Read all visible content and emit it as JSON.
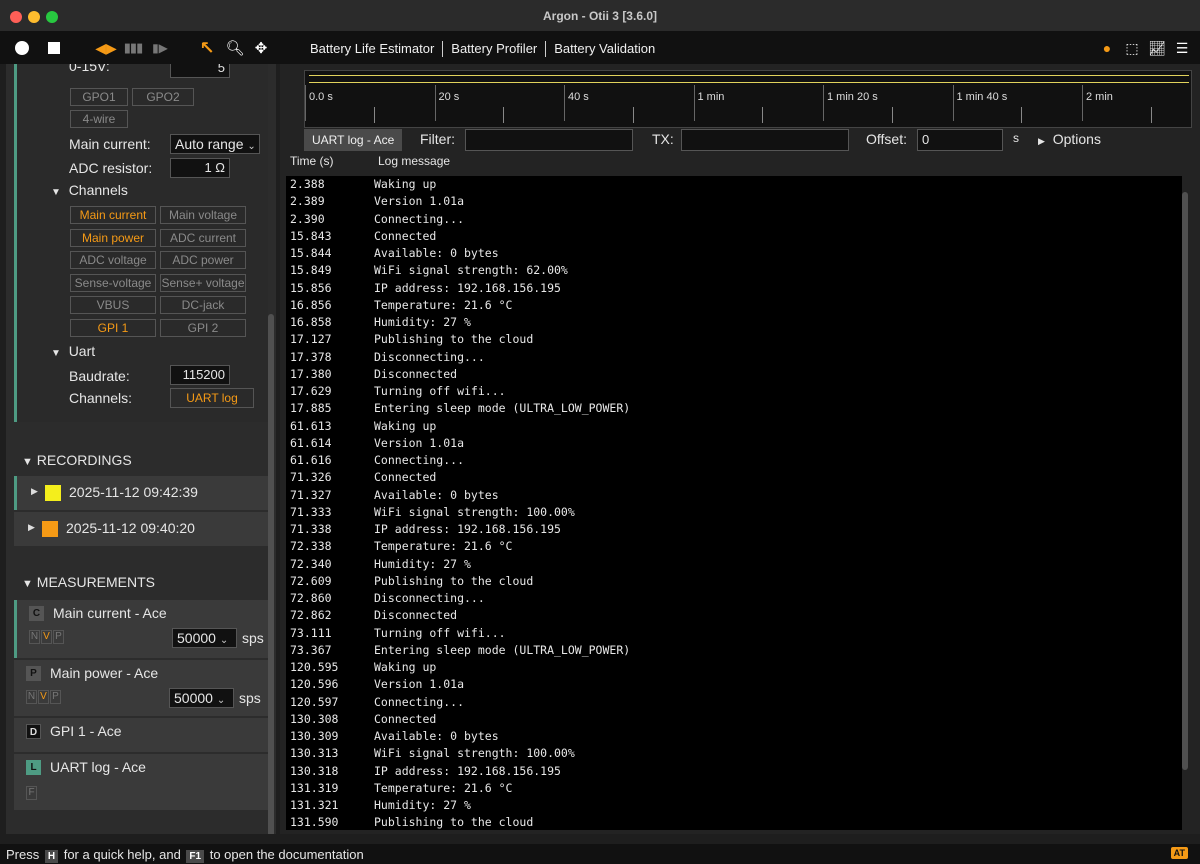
{
  "window": {
    "title": "Argon - Otii 3 [3.6.0]"
  },
  "toolbar": {
    "menu": [
      "Battery Life Estimator",
      "Battery Profiler",
      "Battery Validation"
    ]
  },
  "device": {
    "voltage_label": "0-15V:",
    "voltage_value": "5",
    "gpo": [
      "GPO1",
      "GPO2"
    ],
    "fourwire": "4-wire",
    "main_current_label": "Main current:",
    "main_current_value": "Auto range",
    "adc_resistor_label": "ADC resistor:",
    "adc_resistor_value": "1 Ω",
    "channels_label": "Channels",
    "channels": [
      {
        "label": "Main current",
        "on": true
      },
      {
        "label": "Main voltage",
        "on": false
      },
      {
        "label": "Main power",
        "on": true
      },
      {
        "label": "ADC current",
        "on": false
      },
      {
        "label": "ADC voltage",
        "on": false
      },
      {
        "label": "ADC power",
        "on": false
      },
      {
        "label": "Sense-voltage",
        "on": false
      },
      {
        "label": "Sense+ voltage",
        "on": false
      },
      {
        "label": "VBUS",
        "on": false
      },
      {
        "label": "DC-jack",
        "on": false
      },
      {
        "label": "GPI 1",
        "on": true
      },
      {
        "label": "GPI 2",
        "on": false
      }
    ],
    "uart_label": "Uart",
    "baudrate_label": "Baudrate:",
    "baudrate_value": "115200",
    "uart_channels_label": "Channels:",
    "uart_channel": "UART log"
  },
  "recordings": {
    "header": "RECORDINGS",
    "items": [
      {
        "label": "2025-11-12 09:42:39",
        "color": "#f4ee1c"
      },
      {
        "label": "2025-11-12 09:40:20",
        "color": "#f59a16"
      }
    ]
  },
  "measurements": {
    "header": "MEASUREMENTS",
    "items": [
      {
        "icon": "C",
        "label": "Main current - Ace",
        "sps": "50000",
        "unit": "sps"
      },
      {
        "icon": "P",
        "label": "Main power - Ace",
        "sps": "50000",
        "unit": "sps"
      },
      {
        "icon": "D",
        "label": "GPI 1 - Ace"
      },
      {
        "icon": "L",
        "label": "UART log - Ace",
        "filter": "F"
      }
    ],
    "nvp": [
      "N",
      "V",
      "P"
    ]
  },
  "timeline": {
    "ticks": [
      "0.0 s",
      "20 s",
      "40 s",
      "1 min",
      "1 min 20 s",
      "1 min 40 s",
      "2 min"
    ]
  },
  "log": {
    "tab": "UART log - Ace",
    "filter_label": "Filter:",
    "filter_value": "",
    "tx_label": "TX:",
    "tx_value": "",
    "offset_label": "Offset:",
    "offset_value": "0",
    "offset_unit": "s",
    "options_label": "Options",
    "col_time": "Time (s)",
    "col_msg": "Log message",
    "rows": [
      [
        "2.388",
        "Waking up"
      ],
      [
        "2.389",
        "Version 1.01a"
      ],
      [
        "2.390",
        "Connecting..."
      ],
      [
        "15.843",
        "Connected"
      ],
      [
        "15.844",
        "Available: 0 bytes"
      ],
      [
        "15.849",
        "WiFi signal strength: 62.00%"
      ],
      [
        "15.856",
        "IP address: 192.168.156.195"
      ],
      [
        "16.856",
        "Temperature: 21.6 °C"
      ],
      [
        "16.858",
        "Humidity: 27 %"
      ],
      [
        "17.127",
        "Publishing to the cloud"
      ],
      [
        "17.378",
        "Disconnecting..."
      ],
      [
        "17.380",
        "Disconnected"
      ],
      [
        "17.629",
        "Turning off wifi..."
      ],
      [
        "17.885",
        "Entering sleep mode (ULTRA_LOW_POWER)"
      ],
      [
        "61.613",
        "Waking up"
      ],
      [
        "61.614",
        "Version 1.01a"
      ],
      [
        "61.616",
        "Connecting..."
      ],
      [
        "71.326",
        "Connected"
      ],
      [
        "71.327",
        "Available: 0 bytes"
      ],
      [
        "71.333",
        "WiFi signal strength: 100.00%"
      ],
      [
        "71.338",
        "IP address: 192.168.156.195"
      ],
      [
        "72.338",
        "Temperature: 21.6 °C"
      ],
      [
        "72.340",
        "Humidity: 27 %"
      ],
      [
        "72.609",
        "Publishing to the cloud"
      ],
      [
        "72.860",
        "Disconnecting..."
      ],
      [
        "72.862",
        "Disconnected"
      ],
      [
        "73.111",
        "Turning off wifi..."
      ],
      [
        "73.367",
        "Entering sleep mode (ULTRA_LOW_POWER)"
      ],
      [
        "120.595",
        "Waking up"
      ],
      [
        "120.596",
        "Version 1.01a"
      ],
      [
        "120.597",
        "Connecting..."
      ],
      [
        "130.308",
        "Connected"
      ],
      [
        "130.309",
        "Available: 0 bytes"
      ],
      [
        "130.313",
        "WiFi signal strength: 100.00%"
      ],
      [
        "130.318",
        "IP address: 192.168.156.195"
      ],
      [
        "131.319",
        "Temperature: 21.6 °C"
      ],
      [
        "131.321",
        "Humidity: 27 %"
      ],
      [
        "131.590",
        "Publishing to the cloud"
      ]
    ]
  },
  "statusbar": {
    "press": "Press",
    "key_h": "H",
    "mid": "for a quick help, and",
    "key_f1": "F1",
    "end": "to open the documentation",
    "badge": "AT"
  },
  "colors": {
    "accent": "#f59a16",
    "panel_bar": "#4e9b83",
    "recording_1": "#f4ee1c"
  }
}
